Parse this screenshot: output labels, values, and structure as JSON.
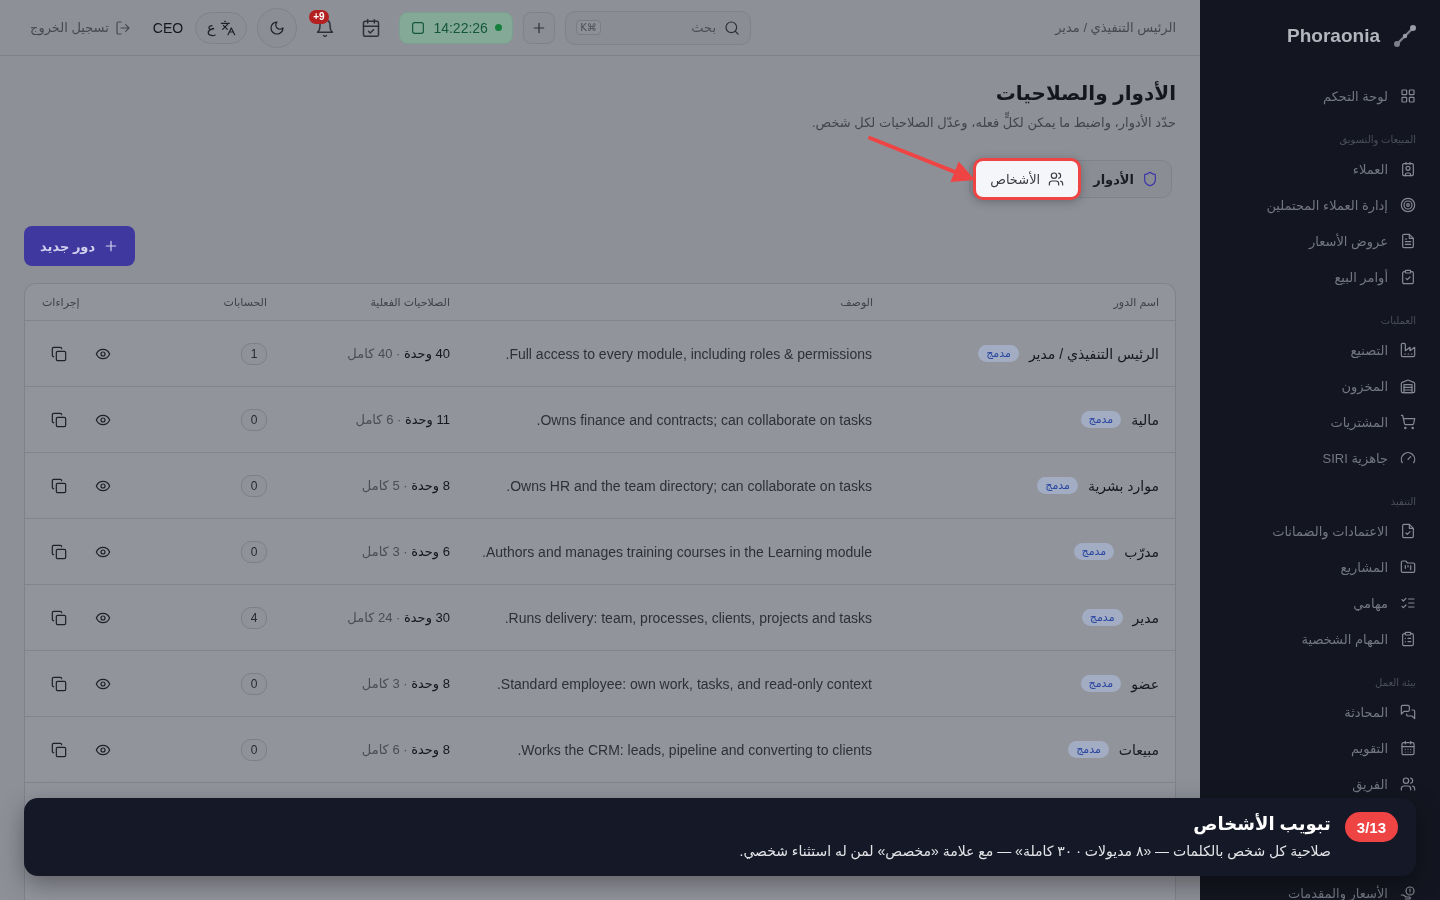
{
  "sidebar": {
    "brand": "Phoraonia",
    "sections": [
      {
        "items": [
          {
            "label": "لوحة التحكم"
          }
        ]
      },
      {
        "title": "المبيعات والتسويق",
        "items": [
          {
            "label": "العملاء"
          },
          {
            "label": "إدارة العملاء المحتملين"
          },
          {
            "label": "عروض الأسعار"
          },
          {
            "label": "أوامر البيع"
          }
        ]
      },
      {
        "title": "العمليات",
        "items": [
          {
            "label": "التصنيع"
          },
          {
            "label": "المخزون"
          },
          {
            "label": "المشتريات"
          },
          {
            "label": "جاهزية SIRI"
          }
        ]
      },
      {
        "title": "التنفيذ",
        "items": [
          {
            "label": "الاعتمادات والضمانات"
          },
          {
            "label": "المشاريع"
          },
          {
            "label": "مهامي"
          },
          {
            "label": "المهام الشخصية"
          }
        ]
      },
      {
        "title": "بيئة العمل",
        "items": [
          {
            "label": "المحادثة"
          },
          {
            "label": "التقويم"
          },
          {
            "label": "الفريق"
          },
          {
            "label": "الأسعار والمقدمات"
          }
        ]
      }
    ]
  },
  "topbar": {
    "breadcrumb": "الرئيس التنفيذي / مدير",
    "search": {
      "placeholder": "بحث",
      "shortcut": "⌘K"
    },
    "clock": "14:22:26",
    "notifications_badge": "9+",
    "language_label": "ع",
    "user_role": "CEO",
    "logout": "تسجيل الخروج"
  },
  "page": {
    "title": "الأدوار والصلاحيات",
    "subtitle": "حدّد الأدوار، واضبط ما يمكن لكلٍّ فعله، وعدّل الصلاحيات لكل شخص.",
    "tabs": [
      {
        "label": "الأدوار",
        "selected": true,
        "highlighted": false
      },
      {
        "label": "الأشخاص",
        "selected": false,
        "highlighted": true
      }
    ],
    "new_button": "دور جديد"
  },
  "table": {
    "columns": [
      "اسم الدور",
      "الوصف",
      "الصلاحيات الفعلية",
      "الحسابات",
      "إجراءات"
    ],
    "rows": [
      {
        "name": "الرئيس التنفيذي / مدير",
        "tag": "مدمج",
        "description": "Full access to every module, including roles & permissions.",
        "permissions": "**40 وحدة** · 40 كامل",
        "accounts": "1"
      },
      {
        "name": "مالية",
        "tag": "مدمج",
        "description": "Owns finance and contracts; can collaborate on tasks.",
        "permissions": "**11 وحدة** · 6 كامل",
        "accounts": "0"
      },
      {
        "name": "موارد بشرية",
        "tag": "مدمج",
        "description": "Owns HR and the team directory; can collaborate on tasks.",
        "permissions": "**8 وحدة** · 5 كامل",
        "accounts": "0"
      },
      {
        "name": "مدرّب",
        "tag": "مدمج",
        "description": "Authors and manages training courses in the Learning module.",
        "permissions": "**6 وحدة** · 3 كامل",
        "accounts": "0"
      },
      {
        "name": "مدير",
        "tag": "مدمج",
        "description": "Runs delivery: team, processes, clients, projects and tasks.",
        "permissions": "**30 وحدة** · 24 كامل",
        "accounts": "4"
      },
      {
        "name": "عضو",
        "tag": "مدمج",
        "description": "Standard employee: own work, tasks, and read-only context.",
        "permissions": "**8 وحدة** · 3 كامل",
        "accounts": "0"
      },
      {
        "name": "مبيعات",
        "tag": "مدمج",
        "description": "Works the CRM: leads, pipeline and converting to clients.",
        "permissions": "**8 وحدة** · 6 كامل",
        "accounts": "0"
      }
    ]
  },
  "tour": {
    "step": "3/13",
    "title": "تبويب الأشخاص",
    "body": "صلاحية كل شخص بالكلمات — «٨ مديولات · ٣٠ كاملة» — مع علامة «مخصص» لمن له استثناء شخصي."
  }
}
